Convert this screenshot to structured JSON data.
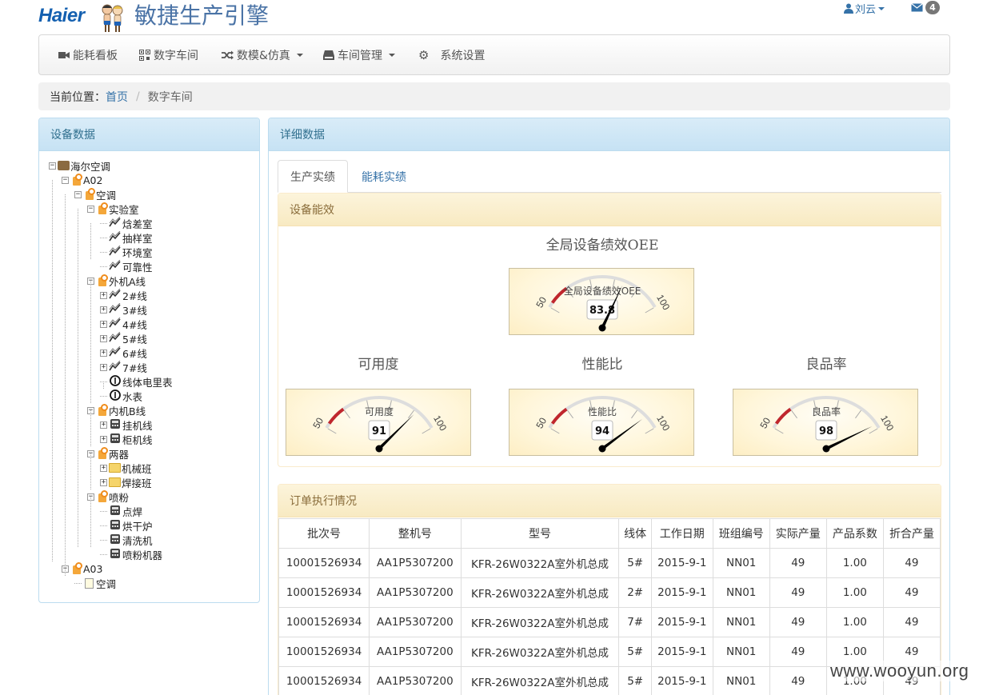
{
  "header": {
    "brand": "Haier",
    "title": "敏捷生产引擎",
    "user": "刘云",
    "mail_count": "4"
  },
  "nav": {
    "items": [
      {
        "label": "能耗看板",
        "icon": "video-camera-icon"
      },
      {
        "label": "数字车间",
        "icon": "qrcode-icon"
      },
      {
        "label": "数模&仿真",
        "icon": "shuffle-icon",
        "dropdown": true
      },
      {
        "label": "车间管理",
        "icon": "hdd-icon",
        "dropdown": true
      },
      {
        "label": "系统设置",
        "icon": "gear-icon"
      }
    ]
  },
  "breadcrumb": {
    "prefix": "当前位置：",
    "home": "首页",
    "current": "数字车间"
  },
  "left_panel": {
    "title": "设备数据",
    "tree": [
      {
        "label": "海尔空调",
        "icon": "box-icon",
        "level": 0,
        "toggle": "-"
      },
      {
        "label": "A02",
        "icon": "org-icon",
        "level": 1,
        "toggle": "-"
      },
      {
        "label": "空调",
        "icon": "org-icon",
        "level": 2,
        "toggle": "-"
      },
      {
        "label": "实验室",
        "icon": "org-icon",
        "level": 3,
        "toggle": "-"
      },
      {
        "label": "焓差室",
        "icon": "line-chart-icon",
        "level": 4,
        "toggle": ""
      },
      {
        "label": "抽样室",
        "icon": "line-chart-icon",
        "level": 4,
        "toggle": ""
      },
      {
        "label": "环境室",
        "icon": "line-chart-icon",
        "level": 4,
        "toggle": ""
      },
      {
        "label": "可靠性",
        "icon": "line-chart-icon",
        "level": 4,
        "toggle": ""
      },
      {
        "label": "外机A线",
        "icon": "org-icon",
        "level": 3,
        "toggle": "-"
      },
      {
        "label": "2#线",
        "icon": "line-chart-icon",
        "level": 4,
        "toggle": "+"
      },
      {
        "label": "3#线",
        "icon": "line-chart-icon",
        "level": 4,
        "toggle": "+"
      },
      {
        "label": "4#线",
        "icon": "line-chart-icon",
        "level": 4,
        "toggle": "+"
      },
      {
        "label": "5#线",
        "icon": "line-chart-icon",
        "level": 4,
        "toggle": "+"
      },
      {
        "label": "6#线",
        "icon": "line-chart-icon",
        "level": 4,
        "toggle": "+"
      },
      {
        "label": "7#线",
        "icon": "line-chart-icon",
        "level": 4,
        "toggle": "+"
      },
      {
        "label": "线体电里表",
        "icon": "meter-icon",
        "level": 4,
        "toggle": ""
      },
      {
        "label": "水表",
        "icon": "meter-icon",
        "level": 4,
        "toggle": ""
      },
      {
        "label": "内机B线",
        "icon": "org-icon",
        "level": 3,
        "toggle": "-"
      },
      {
        "label": "挂机线",
        "icon": "machine-icon",
        "level": 4,
        "toggle": "+"
      },
      {
        "label": "柜机线",
        "icon": "machine-icon",
        "level": 4,
        "toggle": "+"
      },
      {
        "label": "两器",
        "icon": "org-icon",
        "level": 3,
        "toggle": "-"
      },
      {
        "label": "机械班",
        "icon": "folder-icon",
        "level": 4,
        "toggle": "+"
      },
      {
        "label": "焊接班",
        "icon": "folder-icon",
        "level": 4,
        "toggle": "+"
      },
      {
        "label": "喷粉",
        "icon": "org-icon",
        "level": 3,
        "toggle": "-"
      },
      {
        "label": "点焊",
        "icon": "machine-icon",
        "level": 4,
        "toggle": ""
      },
      {
        "label": "烘干炉",
        "icon": "machine-icon",
        "level": 4,
        "toggle": ""
      },
      {
        "label": "清洗机",
        "icon": "machine-icon",
        "level": 4,
        "toggle": ""
      },
      {
        "label": "喷粉机器",
        "icon": "machine-icon",
        "level": 4,
        "toggle": ""
      },
      {
        "label": "A03",
        "icon": "org-icon",
        "level": 1,
        "toggle": "-"
      },
      {
        "label": "空调",
        "icon": "document-icon",
        "level": 2,
        "toggle": ""
      }
    ]
  },
  "right_panel": {
    "title": "详细数据",
    "tabs": [
      {
        "label": "生产实绩",
        "active": true
      },
      {
        "label": "能耗实绩",
        "active": false
      }
    ],
    "efficiency": {
      "title": "设备能效",
      "gauges": [
        {
          "title": "全局设备绩效OEE",
          "label": "全局设备绩效OEE",
          "value": "83.8",
          "min": "50",
          "max": "100"
        },
        {
          "title": "可用度",
          "label": "可用度",
          "value": "91",
          "min": "50",
          "max": "100"
        },
        {
          "title": "性能比",
          "label": "性能比",
          "value": "94",
          "min": "50",
          "max": "100"
        },
        {
          "title": "良品率",
          "label": "良品率",
          "value": "98",
          "min": "50",
          "max": "100"
        }
      ]
    },
    "orders": {
      "title": "订单执行情况",
      "columns": [
        "批次号",
        "整机号",
        "型号",
        "线体",
        "工作日期",
        "班组编号",
        "实际产量",
        "产品系数",
        "折合产量"
      ],
      "rows": [
        [
          "10001526934",
          "AA1P5307200",
          "KFR-26W0322A室外机总成",
          "5#",
          "2015-9-1",
          "NN01",
          "49",
          "1.00",
          "49"
        ],
        [
          "10001526934",
          "AA1P5307200",
          "KFR-26W0322A室外机总成",
          "2#",
          "2015-9-1",
          "NN01",
          "49",
          "1.00",
          "49"
        ],
        [
          "10001526934",
          "AA1P5307200",
          "KFR-26W0322A室外机总成",
          "7#",
          "2015-9-1",
          "NN01",
          "49",
          "1.00",
          "49"
        ],
        [
          "10001526934",
          "AA1P5307200",
          "KFR-26W0322A室外机总成",
          "5#",
          "2015-9-1",
          "NN01",
          "49",
          "1.00",
          "49"
        ],
        [
          "10001526934",
          "AA1P5307200",
          "KFR-26W0322A室外机总成",
          "5#",
          "2015-9-1",
          "NN01",
          "49",
          "1.00",
          "49"
        ]
      ]
    }
  },
  "watermark": "www.wooyun.org",
  "colors": {
    "accent": "#3572a8",
    "panel_blue": "#d9ecf8",
    "panel_yellow": "#fcf4db",
    "gauge_red": "#c0272d"
  }
}
